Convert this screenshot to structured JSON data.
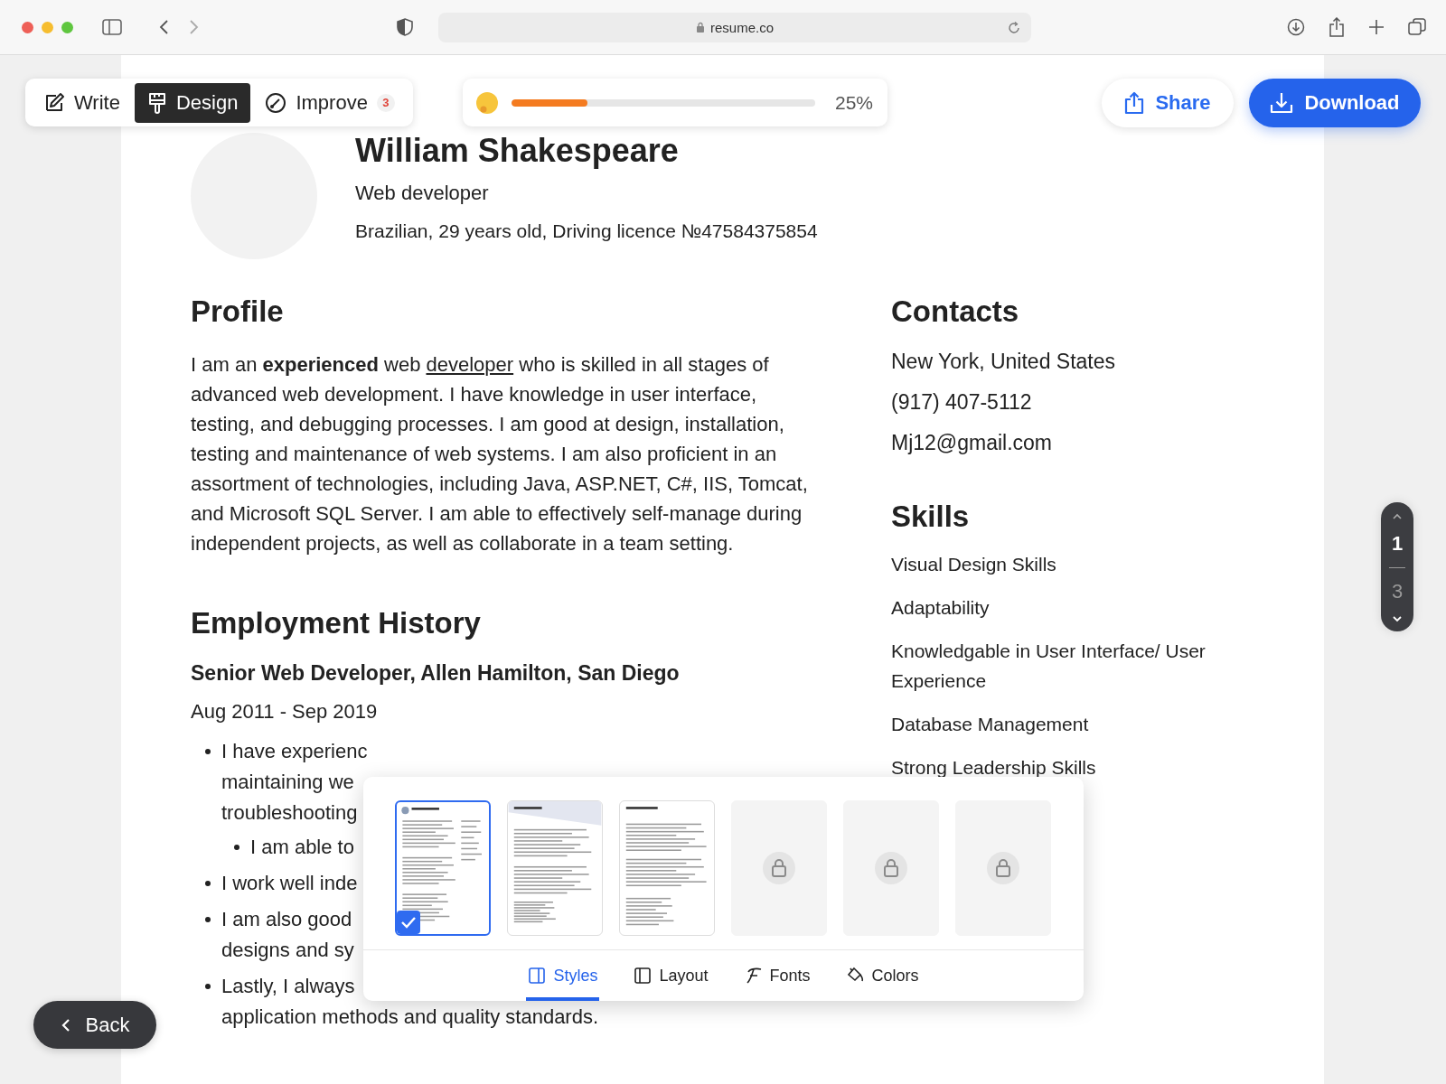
{
  "browser": {
    "url": "resume.co"
  },
  "toolbar": {
    "modes": [
      {
        "label": "Write",
        "selected": false,
        "kind": "write"
      },
      {
        "label": "Design",
        "selected": true,
        "kind": "design"
      },
      {
        "label": "Improve",
        "selected": false,
        "kind": "improve",
        "badge": "3"
      }
    ],
    "progress": {
      "level": 0.25,
      "reading": "25%"
    },
    "share": "Share",
    "download": "Download"
  },
  "resume": {
    "name": "William Shakespeare",
    "job_title": "Web developer",
    "details": "Brazilian, 29 years old, Driving licence №47584375854",
    "profile": {
      "heading": "Profile",
      "before": "I am an **experienced** web ",
      "link": "developer",
      "after": " who is skilled in all stages of advanced web development. I have knowledge in user interface, testing, and debugging processes. I am good at design, installation, testing and maintenance of web systems. I am also proficient in an assortment of technologies, including Java, ASP.NET, C#, IIS, Tomcat, and Microsoft SQL Server. I am able to effectively self-manage during independent projects, as well as collaborate in a team setting."
    },
    "employment": {
      "heading": "Employment History",
      "job": "Senior Web Developer, Allen Hamilton,  San Diego",
      "dates": "Aug 2011 - Sep 2019",
      "bullets": [
        {
          "lines": [
            "I have experienc",
            "maintaining we",
            "troubleshooting"
          ],
          "children": [
            {
              "lines": [
                "I am able to"
              ]
            }
          ]
        },
        {
          "lines": [
            "I work well inde"
          ]
        },
        {
          "lines": [
            "I am also good",
            "designs and sy"
          ]
        },
        {
          "lines": [
            "Lastly, I always",
            "application methods and quality standards."
          ]
        }
      ]
    },
    "contacts": {
      "heading": "Contacts",
      "items": [
        "New York, United States",
        "(917) 407-5112",
        "Mj12@gmail.com"
      ]
    },
    "skills": {
      "heading": "Skills",
      "items": [
        "Visual Design Skills",
        "Adaptability",
        "Knowledgable in User Interface/ User Experience",
        "Database Management",
        "Strong Leadership Skills"
      ]
    }
  },
  "design_panel": {
    "templates": [
      {
        "kind": "two-column",
        "selected": true
      },
      {
        "kind": "banner",
        "selected": false
      },
      {
        "kind": "single",
        "selected": false
      },
      {
        "kind": "locked",
        "selected": false
      },
      {
        "kind": "locked",
        "selected": false
      },
      {
        "kind": "locked",
        "selected": false
      }
    ],
    "tabs": [
      {
        "label": "Styles",
        "selected": true,
        "kind": "styles"
      },
      {
        "label": "Layout",
        "selected": false,
        "kind": "layout"
      },
      {
        "label": "Fonts",
        "selected": false,
        "kind": "fonts"
      },
      {
        "label": "Colors",
        "selected": false,
        "kind": "colors"
      }
    ]
  },
  "back": "Back",
  "pager": {
    "current": "1",
    "total": "3"
  }
}
